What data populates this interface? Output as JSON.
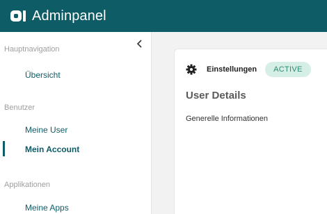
{
  "header": {
    "title": "Adminpanel",
    "logo_icon": "company-logo-icon",
    "color": "#0e5c66"
  },
  "sidebar": {
    "collapse_icon": "chevron-left-icon",
    "sections": [
      {
        "label": "Hauptnavigation",
        "items": [
          {
            "label": "Übersicht",
            "active": false
          }
        ]
      },
      {
        "label": "Benutzer",
        "items": [
          {
            "label": "Meine User",
            "active": false
          },
          {
            "label": "Mein Account",
            "active": true
          }
        ]
      },
      {
        "label": "Applikationen",
        "items": [
          {
            "label": "Meine Apps",
            "active": false
          }
        ]
      }
    ]
  },
  "card": {
    "icon": "gear-icon",
    "settings_label": "Einstellungen",
    "status": "ACTIVE",
    "status_color": "#2f8a73",
    "title": "User Details",
    "subtitle": "Generelle Informationen"
  }
}
